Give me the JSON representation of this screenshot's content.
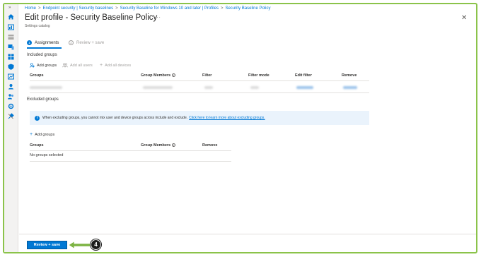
{
  "breadcrumb": [
    "Home",
    "Endpoint security | Security baselines",
    "Security Baseline for Windows 10 and later | Profiles",
    "Security Baseline Policy"
  ],
  "page": {
    "title": "Edit profile - Security Baseline Policy",
    "subtitle": "Settings catalog",
    "more": "···",
    "close": "✕"
  },
  "steps": [
    {
      "number": "1",
      "label": "Assignments",
      "state": "active"
    },
    {
      "number": "2",
      "label": "Review + save",
      "state": "inactive"
    }
  ],
  "included": {
    "label": "Included groups",
    "commands": {
      "add_groups": "Add groups",
      "add_all_users": "Add all users",
      "add_all_devices": "Add all devices"
    },
    "columns": {
      "groups": "Groups",
      "group_members": "Group Members",
      "filter": "Filter",
      "filter_mode": "Filter mode",
      "edit_filter": "Edit filter",
      "remove": "Remove"
    }
  },
  "excluded": {
    "label": "Excluded groups",
    "info_text": "When excluding groups, you cannot mix user and device groups across include and exclude.",
    "info_link": "Click here to learn more about excluding groups.",
    "commands": {
      "add_groups": "Add groups"
    },
    "columns": {
      "groups": "Groups",
      "group_members": "Group Members",
      "remove": "Remove"
    },
    "empty_text": "No groups selected"
  },
  "footer": {
    "review_button": "Review + save",
    "callout_number": "4"
  },
  "colors": {
    "accent": "#0078d4",
    "frame_border": "#8bc34a",
    "callout_arrow": "#7cb342",
    "info_background": "#eaf3fc"
  },
  "icons": {
    "sidebar": [
      "chevron-right-icon",
      "home-icon",
      "dashboard-icon",
      "all-services-icon",
      "devices-icon",
      "apps-icon",
      "endpoint-security-icon",
      "reports-icon",
      "users-icon",
      "groups-icon",
      "tenant-admin-icon",
      "troubleshooting-icon"
    ],
    "info": "info-icon",
    "add_groups": "person-add-icon",
    "add_all_users": "users-icon",
    "add_all_devices": "plus-icon"
  }
}
